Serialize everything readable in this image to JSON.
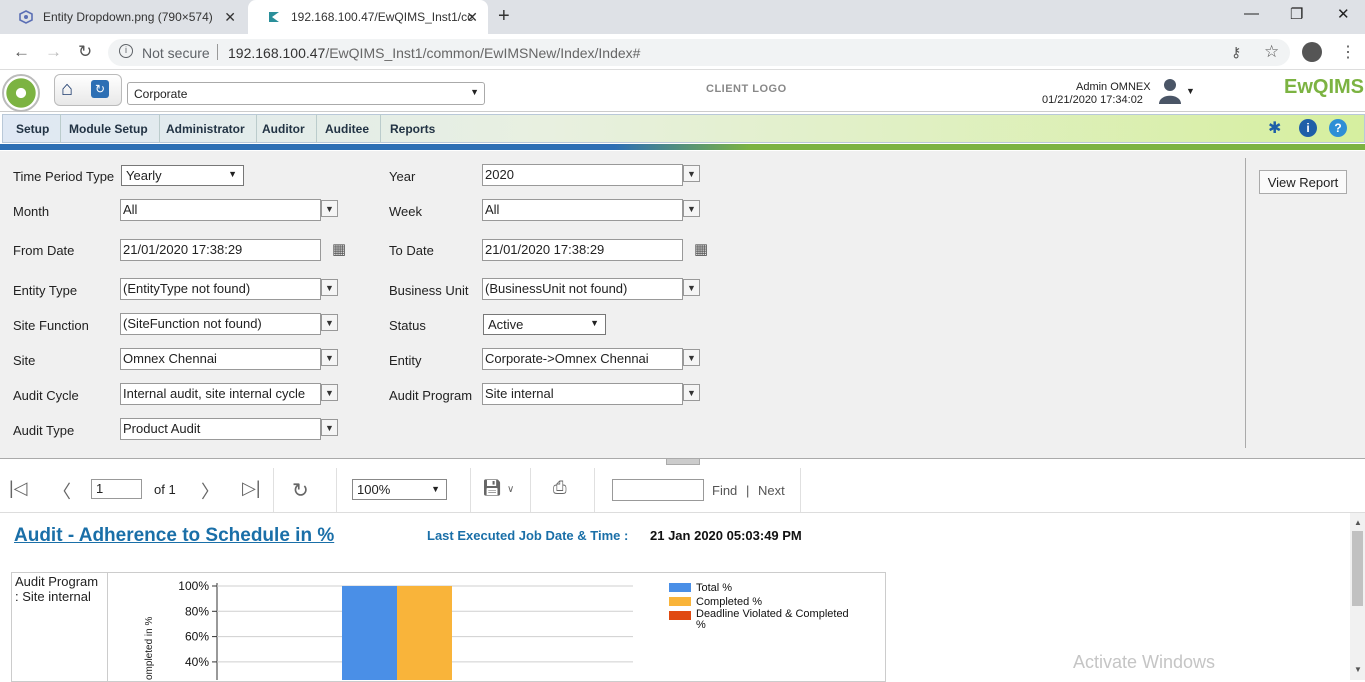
{
  "browser": {
    "tabs": [
      {
        "title": "Entity Dropdown.png (790×574)"
      },
      {
        "title": "192.168.100.47/EwQIMS_Inst1/cc"
      }
    ],
    "not_secure": "Not secure",
    "url_host": "192.168.100.47",
    "url_path": "/EwQIMS_Inst1/common/EwIMSNew/Index/Index#"
  },
  "header": {
    "corporate_select": "Corporate",
    "client_logo": "CLIENT LOGO",
    "user_name": "Admin OMNEX",
    "datetime": "01/21/2020 17:34:02",
    "brand": "EwQIMS"
  },
  "menu": {
    "items": [
      "Setup",
      "Module Setup",
      "Administrator",
      "Auditor",
      "Auditee",
      "Reports"
    ]
  },
  "form": {
    "time_period_type": {
      "label": "Time Period Type",
      "value": "Yearly"
    },
    "year": {
      "label": "Year",
      "value": "2020"
    },
    "month": {
      "label": "Month",
      "value": "All"
    },
    "week": {
      "label": "Week",
      "value": "All"
    },
    "from_date": {
      "label": "From Date",
      "value": "21/01/2020 17:38:29"
    },
    "to_date": {
      "label": "To Date",
      "value": "21/01/2020 17:38:29"
    },
    "entity_type": {
      "label": "Entity Type",
      "value": "(EntityType not found)"
    },
    "business_unit": {
      "label": "Business Unit",
      "value": "(BusinessUnit not found)"
    },
    "site_function": {
      "label": "Site Function",
      "value": "(SiteFunction not found)"
    },
    "status": {
      "label": "Status",
      "value": "Active"
    },
    "site": {
      "label": "Site",
      "value": "Omnex Chennai"
    },
    "entity": {
      "label": "Entity",
      "value": "Corporate->Omnex Chennai"
    },
    "audit_cycle": {
      "label": "Audit Cycle",
      "value": "Internal audit, site internal cycle"
    },
    "audit_program": {
      "label": "Audit Program",
      "value": "Site internal"
    },
    "audit_type": {
      "label": "Audit Type",
      "value": "Product Audit"
    },
    "view_report": "View Report"
  },
  "toolbar": {
    "page": "1",
    "of_label": "of 1",
    "zoom": "100%",
    "find_label": "Find",
    "sep": "|",
    "next_label": "Next"
  },
  "report": {
    "title": "Audit - Adherence to Schedule in %",
    "last_exec_label": "Last Executed Job Date & Time :",
    "last_exec_value": "21 Jan 2020 05:03:49 PM",
    "program_cell": "Audit Program\n: Site internal",
    "watermark": "Activate Windows"
  },
  "chart_data": {
    "type": "bar",
    "ylabel": "ompleted in %",
    "y_ticks": [
      "100%",
      "80%",
      "60%",
      "40%"
    ],
    "ylim": [
      40,
      100
    ],
    "series": [
      {
        "name": "Total %",
        "color": "#4a8fe7",
        "values": [
          100
        ]
      },
      {
        "name": "Completed %",
        "color": "#f9b43a",
        "values": [
          100
        ]
      },
      {
        "name": "Deadline Violated & Completed %",
        "color": "#e04a12",
        "values": [
          0
        ]
      }
    ]
  }
}
